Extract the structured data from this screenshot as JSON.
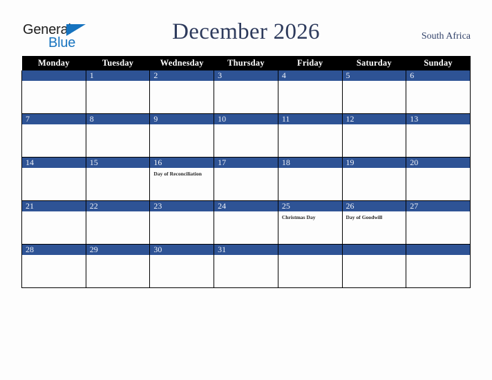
{
  "logo": {
    "text_top": "General",
    "text_bottom": "Blue",
    "triangle_color": "#1673bf",
    "icon": "general-blue-logo"
  },
  "header": {
    "title": "December 2026",
    "country": "South Africa",
    "title_color": "#2d3a5c"
  },
  "colors": {
    "day_band": "#2e5395",
    "header_bg": "#000000",
    "page_bg": "#fdfdfd",
    "grid_line": "#000000",
    "holiday_text": "#262626"
  },
  "calendar": {
    "month": "December",
    "year": 2026,
    "weekday_headers": [
      "Monday",
      "Tuesday",
      "Wednesday",
      "Thursday",
      "Friday",
      "Saturday",
      "Sunday"
    ],
    "weeks": [
      [
        {
          "day": "",
          "holiday": ""
        },
        {
          "day": "1",
          "holiday": ""
        },
        {
          "day": "2",
          "holiday": ""
        },
        {
          "day": "3",
          "holiday": ""
        },
        {
          "day": "4",
          "holiday": ""
        },
        {
          "day": "5",
          "holiday": ""
        },
        {
          "day": "6",
          "holiday": ""
        }
      ],
      [
        {
          "day": "7",
          "holiday": ""
        },
        {
          "day": "8",
          "holiday": ""
        },
        {
          "day": "9",
          "holiday": ""
        },
        {
          "day": "10",
          "holiday": ""
        },
        {
          "day": "11",
          "holiday": ""
        },
        {
          "day": "12",
          "holiday": ""
        },
        {
          "day": "13",
          "holiday": ""
        }
      ],
      [
        {
          "day": "14",
          "holiday": ""
        },
        {
          "day": "15",
          "holiday": ""
        },
        {
          "day": "16",
          "holiday": "Day of Reconciliation"
        },
        {
          "day": "17",
          "holiday": ""
        },
        {
          "day": "18",
          "holiday": ""
        },
        {
          "day": "19",
          "holiday": ""
        },
        {
          "day": "20",
          "holiday": ""
        }
      ],
      [
        {
          "day": "21",
          "holiday": ""
        },
        {
          "day": "22",
          "holiday": ""
        },
        {
          "day": "23",
          "holiday": ""
        },
        {
          "day": "24",
          "holiday": ""
        },
        {
          "day": "25",
          "holiday": "Christmas Day"
        },
        {
          "day": "26",
          "holiday": "Day of Goodwill"
        },
        {
          "day": "27",
          "holiday": ""
        }
      ],
      [
        {
          "day": "28",
          "holiday": ""
        },
        {
          "day": "29",
          "holiday": ""
        },
        {
          "day": "30",
          "holiday": ""
        },
        {
          "day": "31",
          "holiday": ""
        },
        {
          "day": "",
          "holiday": ""
        },
        {
          "day": "",
          "holiday": ""
        },
        {
          "day": "",
          "holiday": ""
        }
      ]
    ]
  }
}
